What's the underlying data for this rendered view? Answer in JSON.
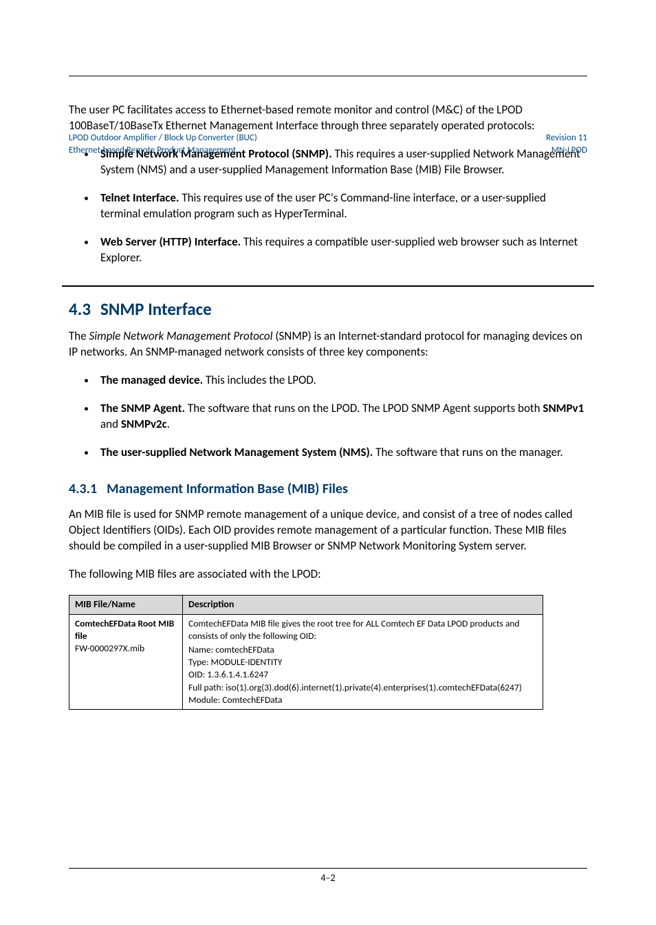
{
  "header": {
    "left": "LPOD Outdoor Amplifier / Block Up Converter (BUC)",
    "right": "Revision 11",
    "subLeft": "Ethernet-based Remote Product Management",
    "subRight": "MN-LPOD"
  },
  "intro": "The user PC facilitates access to Ethernet-based remote monitor and control (M&C) of the LPOD 100BaseT/10BaseTx Ethernet Management Interface through three separately operated protocols:",
  "b1": {
    "lead": "Simple Network Management Protocol (SNMP).",
    "rest": " This requires a user-supplied Network Management System (NMS) and a user-supplied Management Information Base (MIB) File Browser."
  },
  "b2": {
    "lead": "Telnet Interface.",
    "rest": " This requires use of the user PC's Command-line interface, or a user-supplied terminal emulation program such as HyperTerminal."
  },
  "b3": {
    "lead": "Web Server (HTTP) Interface.",
    "rest": " This requires a compatible user-supplied web browser such as Internet Explorer."
  },
  "h1": {
    "num": "4.3",
    "title": "SNMP Interface"
  },
  "snmp_p_pre": "The ",
  "snmp_p_em": "Simple Network Management Protocol",
  "snmp_p_post": " (SNMP) is an Internet-standard protocol for managing devices on IP networks. An SNMP-managed network consists of three key components:",
  "s1": {
    "lead": "The managed device.",
    "rest": " This includes the LPOD."
  },
  "s2": {
    "lead": "The SNMP Agent.",
    "rest_a": " The software that runs on the LPOD. The LPOD SNMP Agent supports both ",
    "b1": "SNMPv1",
    "mid": " and ",
    "b2": "SNMPv2c",
    "end": "."
  },
  "s3": {
    "lead": "The user-supplied Network Management System (NMS).",
    "rest": " The software that runs on the manager."
  },
  "h2": {
    "num": "4.3.1",
    "title": "Management Information Base (MIB) Files"
  },
  "mib_p": "An MIB file is used for SNMP remote management of a unique device, and consist of a tree of nodes called Object Identifiers (OIDs). Each OID provides remote management of a particular function. These MIB files should be compiled in a user-supplied MIB Browser or SNMP Network Monitoring System server.",
  "mib_p2": "The following MIB files are associated with the LPOD:",
  "table": {
    "h1": "MIB File/Name",
    "h2": "Description",
    "r1c1a": "ComtechEFData Root MIB file",
    "r1c1b": "FW-0000297X.mib",
    "r1c2": "ComtechEFData MIB file gives the root tree for ALL Comtech EF Data LPOD products and consists of only the following OID:",
    "r1c2b": "Name: comtechEFData",
    "r1c2c": "Type: MODULE-IDENTITY",
    "r1c2d": "OID: 1.3.6.1.4.1.6247",
    "r1c2e": "Full path: iso(1).org(3).dod(6).internet(1).private(4).enterprises(1).comtechEFData(6247)",
    "r1c2f": "Module: ComtechEFData"
  },
  "footer": "4–2"
}
